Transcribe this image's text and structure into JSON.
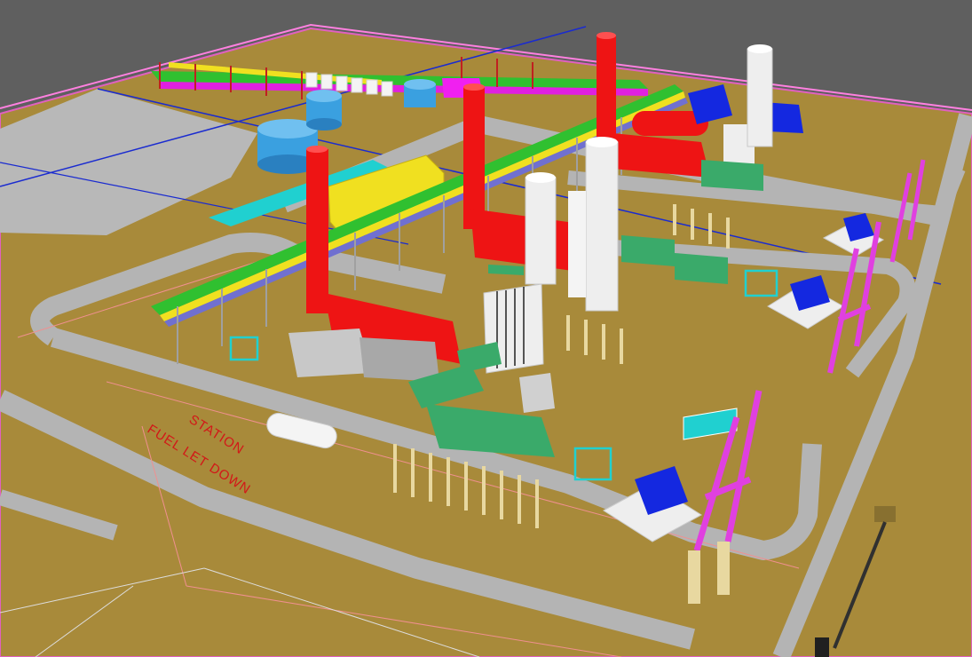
{
  "labels": {
    "line1": "FUEL LET DOWN",
    "line2": "STATION"
  },
  "colors": {
    "background": "#5f5f5f",
    "ground": "#a88a3a",
    "road": "#b4b4b4",
    "stack_red": "#ee1414",
    "hrsg_white": "#eeeeee",
    "tank_blue": "#3aa0e0",
    "transformer_blue": "#1428e0",
    "structure_magenta": "#e040e0",
    "duct_green": "#3aaa6a",
    "pipe_yellow": "#f0e020",
    "pile_tan": "#e8d8a0",
    "cyan": "#20d0d0"
  }
}
